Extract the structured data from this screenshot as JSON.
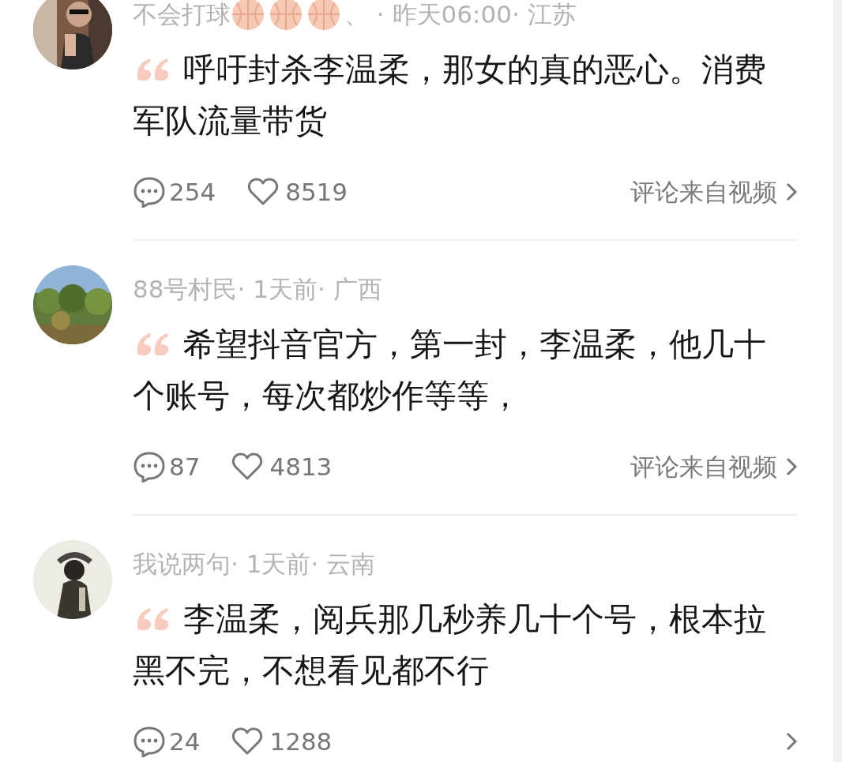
{
  "comments": [
    {
      "author": "不会打球",
      "author_badges": [
        {
          "kind": "basketball"
        },
        {
          "kind": "basketball"
        },
        {
          "kind": "basketball"
        }
      ],
      "meta": "、 · 昨天06:00· 江苏",
      "text": "呼吁封杀李温柔，那女的真的恶心。消费军队流量带货",
      "replies": "254",
      "likes": "8519",
      "source": "评论来自视频"
    },
    {
      "author": "88号村民",
      "meta": "· 1天前· 广西",
      "text": "希望抖音官方，第一封，李温柔，他几十个账号，每次都炒作等等，",
      "replies": "87",
      "likes": "4813",
      "source": "评论来自视频"
    },
    {
      "author": "我说两句",
      "meta": "· 1天前· 云南",
      "text": "李温柔，阅兵那几秒养几十个号，根本拉黑不完，不想看见都不行",
      "replies": "24",
      "likes": "1288"
    }
  ]
}
